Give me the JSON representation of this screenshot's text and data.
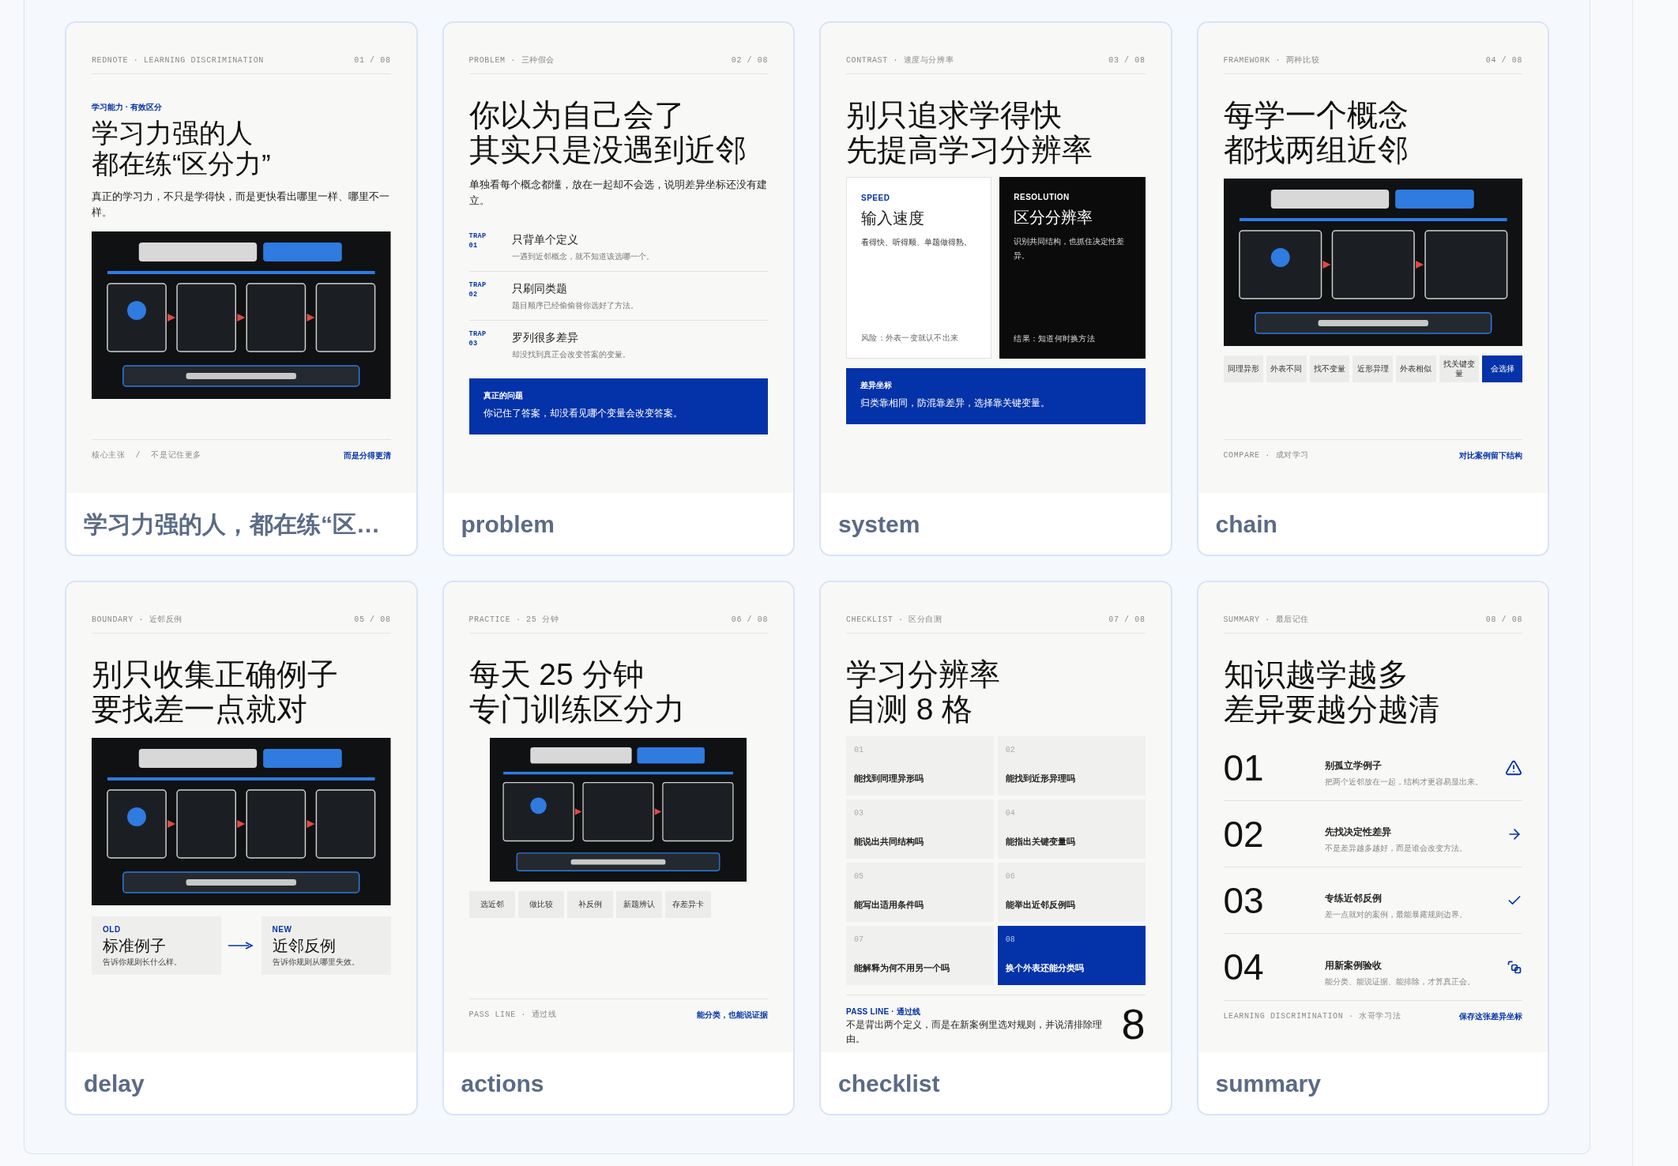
{
  "cards": [
    {
      "kind": "cover",
      "kicker": "REDNOTE · LEARNING DISCRIMINATION",
      "page": "01 / 08",
      "eyebrow": "学习能力 · 有效区分",
      "title": [
        "学习力强的人",
        "都在练“区分力”"
      ],
      "blocks": [
        {
          "kind": "lead",
          "text": "真正的学习力，不只是学得快，而是更快看出哪里一样、哪里不一样。"
        },
        {
          "kind": "picture",
          "narrow": false
        }
      ],
      "footer": {
        "left": "核心主张  /  不是记住更多",
        "right": "而是分得更清"
      },
      "label": "学习力强的人，都在练“区…"
    },
    {
      "kind": "slide",
      "kicker": "PROBLEM · 三种假会",
      "page": "02 / 08",
      "title": [
        "你以为自己会了",
        "其实只是没遇到近邻"
      ],
      "blocks": [
        {
          "kind": "lead",
          "text": "单独看每个概念都懂，放在一起却不会选，说明差异坐标还没有建立。"
        },
        {
          "kind": "traps",
          "items": [
            {
              "tag": "TRAP",
              "num": "01",
              "title": "只背单个定义",
              "text": "一遇到近邻概念，就不知道该选哪一个。"
            },
            {
              "tag": "TRAP",
              "num": "02",
              "title": "只刷同类题",
              "text": "题目顺序已经偷偷替你选好了方法。"
            },
            {
              "tag": "TRAP",
              "num": "03",
              "title": "罗列很多差异",
              "text": "却没找到真正会改变答案的变量。"
            }
          ]
        },
        {
          "kind": "callout",
          "heading": "真正的问题",
          "text": "你记住了答案，却没看见哪个变量会改变答案。"
        }
      ],
      "label": "problem"
    },
    {
      "kind": "slide",
      "kicker": "CONTRAST · 速度与分辨率",
      "page": "03 / 08",
      "title": [
        "别只追求学得快",
        "先提高学习分辨率"
      ],
      "blocks": [
        {
          "kind": "contrast",
          "panels": [
            {
              "tag": "SPEED",
              "title": "输入速度",
              "text": "看得快、听得顺、单题做得熟。",
              "note": "风险：外表一变就认不出来",
              "dark": false
            },
            {
              "tag": "RESOLUTION",
              "title": "区分分辨率",
              "text": "识别共同结构，也抓住决定性差异。",
              "note": "结果：知道何时换方法",
              "dark": true
            }
          ]
        },
        {
          "kind": "callout",
          "heading": "差异坐标",
          "text": "归类靠相同，防混靠差异，选择靠关键变量。"
        }
      ],
      "label": "system"
    },
    {
      "kind": "slide",
      "kicker": "FRAMEWORK · 两种比较",
      "page": "04 / 08",
      "title": [
        "每学一个概念",
        "都找两组近邻"
      ],
      "blocks": [
        {
          "kind": "picture",
          "narrow": false
        },
        {
          "kind": "chips",
          "items": [
            {
              "text": "同理异形",
              "selected": false
            },
            {
              "text": "外表不同",
              "selected": false
            },
            {
              "text": "找不变量",
              "selected": false
            },
            {
              "text": "近形异理",
              "selected": false
            },
            {
              "text": "外表相似",
              "selected": false
            },
            {
              "text": "找关键变量",
              "selected": false
            },
            {
              "text": "会选择",
              "selected": true
            }
          ]
        }
      ],
      "footer": {
        "left": "COMPARE · 成对学习",
        "right": "对比案例留下结构"
      },
      "label": "chain"
    },
    {
      "kind": "slide",
      "kicker": "BOUNDARY · 近邻反例",
      "page": "05 / 08",
      "title": [
        "别只收集正确例子",
        "要找差一点就对"
      ],
      "blocks": [
        {
          "kind": "picture",
          "narrow": false
        },
        {
          "kind": "compare",
          "items": [
            {
              "tag": "OLD",
              "title": "标准例子",
              "text": "告诉你规则长什么样。"
            },
            {
              "tag": "NEW",
              "title": "近邻反例",
              "text": "告诉你规则从哪里失效。"
            }
          ]
        }
      ],
      "label": "delay"
    },
    {
      "kind": "slide",
      "kicker": "PRACTICE · 25 分钟",
      "page": "06 / 08",
      "title": [
        "每天 25 分钟",
        "专门训练区分力"
      ],
      "blocks": [
        {
          "kind": "picture",
          "narrow": true
        },
        {
          "kind": "chips",
          "items": [
            {
              "text": "选近邻",
              "selected": false
            },
            {
              "text": "做比较",
              "selected": false
            },
            {
              "text": "补反例",
              "selected": false
            },
            {
              "text": "新题辨认",
              "selected": false
            },
            {
              "text": "存差异卡",
              "selected": false
            }
          ]
        }
      ],
      "footer": {
        "left": "PASS LINE · 通过线",
        "right": "能分类，也能说证据"
      },
      "label": "actions"
    },
    {
      "kind": "slide",
      "kicker": "CHECKLIST · 区分自测",
      "page": "07 / 08",
      "title": [
        "学习分辨率",
        "自测 8 格"
      ],
      "blocks": [
        {
          "kind": "grid",
          "items": [
            {
              "num": "01",
              "text": "能找到同理异形吗",
              "selected": false
            },
            {
              "num": "02",
              "text": "能找到近形异理吗",
              "selected": false
            },
            {
              "num": "03",
              "text": "能说出共同结构吗",
              "selected": false
            },
            {
              "num": "04",
              "text": "能指出关键变量吗",
              "selected": false
            },
            {
              "num": "05",
              "text": "能写出适用条件吗",
              "selected": false
            },
            {
              "num": "06",
              "text": "能举出近邻反例吗",
              "selected": false
            },
            {
              "num": "07",
              "text": "能解释为何不用另一个吗",
              "selected": false
            },
            {
              "num": "08",
              "text": "换个外表还能分类吗",
              "selected": true
            }
          ]
        },
        {
          "kind": "pass",
          "label": "PASS LINE · 通过线",
          "text": "不是背出两个定义，而是在新案例里选对规则，并说清排除理由。",
          "big": "8"
        }
      ],
      "label": "checklist"
    },
    {
      "kind": "slide",
      "kicker": "SUMMARY · 最后记住",
      "page": "08 / 08",
      "title": [
        "知识越学越多",
        "差异要越分越清"
      ],
      "blocks": [
        {
          "kind": "numbered",
          "items": [
            {
              "num": "01",
              "title": "别孤立学例子",
              "text": "把两个近邻放在一起，结构才更容易显出来。"
            },
            {
              "num": "02",
              "title": "先找决定性差异",
              "text": "不是差异越多越好，而是谁会改变方法。"
            },
            {
              "num": "03",
              "title": "专练近邻反例",
              "text": "差一点就对的案例，最能暴露规则边界。"
            },
            {
              "num": "04",
              "title": "用新案例验收",
              "text": "能分类、能说证据、能排除，才算真正会。"
            }
          ]
        }
      ],
      "footer": {
        "left": "LEARNING DISCRIMINATION · 水哥学习法",
        "right": "保存这张差异坐标"
      },
      "label": "summary"
    }
  ]
}
